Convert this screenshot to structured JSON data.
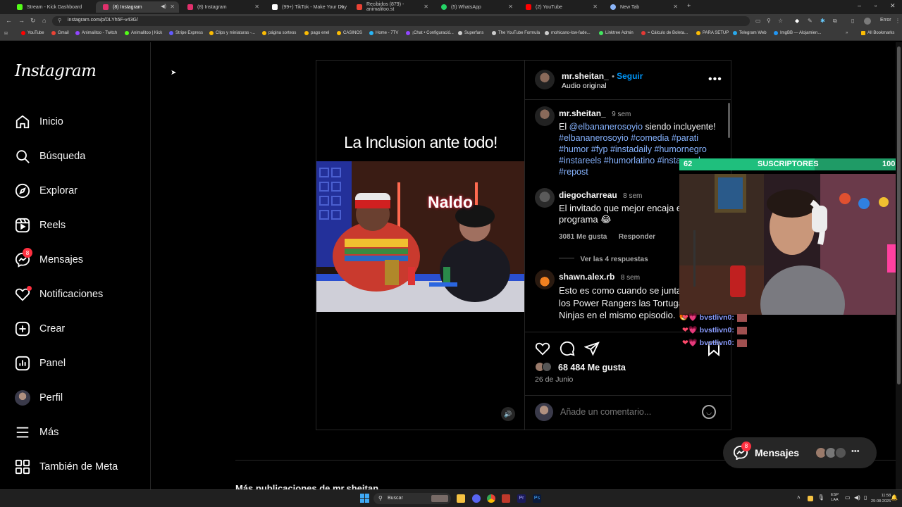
{
  "browser": {
    "tabs": [
      {
        "title": "Stream - Kick Dashboard",
        "color": "#53fc18"
      },
      {
        "title": "(8) Instagram",
        "color": "#e1306c"
      },
      {
        "title": "(8) Instagram",
        "color": "#e1306c"
      },
      {
        "title": "(99+) TikTok - Make Your Day",
        "color": "#ffffff"
      },
      {
        "title": "Recibidos (879) - animalitoo.st",
        "color": "#ea4335"
      },
      {
        "title": "(5) WhatsApp",
        "color": "#25d366"
      },
      {
        "title": "(2) YouTube",
        "color": "#ff0000"
      },
      {
        "title": "New Tab",
        "color": "#8ab4f8"
      }
    ],
    "url": "instagram.com/p/DLYh5F-v43G/",
    "profile_label": "Error",
    "bookmarks": [
      "YouTube",
      "Gmail",
      "Animalitoo - Twitch",
      "Animalitoo | Kick",
      "Stripe Express",
      "Clips y miniaturas -...",
      "página sorteos",
      "pago enel",
      "CASINOS",
      "Home - 7TV",
      "¡Chat • Configuració...",
      "Superfans",
      "The YouTube Formula",
      "mohicano-low-fade...",
      "Linktree Admin",
      "≈ Cálculo de Boleta...",
      "PARA SETUP",
      "Telegram Web",
      "ImgBB — Alojamien..."
    ],
    "all_bookmarks": "All Bookmarks"
  },
  "sidebar": {
    "logo": "Instagram",
    "items": [
      {
        "label": "Inicio",
        "icon": "home-icon"
      },
      {
        "label": "Búsqueda",
        "icon": "search-icon"
      },
      {
        "label": "Explorar",
        "icon": "compass-icon"
      },
      {
        "label": "Reels",
        "icon": "reels-icon"
      },
      {
        "label": "Mensajes",
        "icon": "messenger-icon",
        "badge": "8"
      },
      {
        "label": "Notificaciones",
        "icon": "heart-icon"
      },
      {
        "label": "Crear",
        "icon": "plus-square-icon"
      },
      {
        "label": "Panel",
        "icon": "dashboard-icon"
      },
      {
        "label": "Perfil",
        "icon": "avatar-icon"
      },
      {
        "label": "Más",
        "icon": "menu-icon"
      },
      {
        "label": "También de Meta",
        "icon": "meta-icon"
      }
    ]
  },
  "post": {
    "video_title": "La Inclusion ante todo!",
    "video_logo": "Naldo",
    "author": "mr.sheitan_",
    "follow": "Seguir",
    "audio": "Audio original",
    "caption": {
      "author": "mr.sheitan_",
      "time": "9 sem",
      "pre": "El",
      "mention": "@elbananerosoyio",
      "text": "siendo incluyente!",
      "hashtags": "#elbananerosoyio #comedia #parati #humor #fyp #instadaily #humornegro #instareels #humorlatino #instagood #repost"
    },
    "comments": [
      {
        "author": "diegocharreau",
        "time": "8 sem",
        "text": "El invitado que mejor encaja el programa 😂",
        "likes": "3081 Me gusta",
        "reply": "Responder",
        "replies": "Ver las 4 respuestas"
      },
      {
        "author": "shawn.alex.rb",
        "time": "8 sem",
        "text": "Esto es como cuando se juntaban los Power Rangers las Tortugas Ninjas en el mismo episodio. 🔥"
      }
    ],
    "likes": "68 484 Me gusta",
    "date": "26 de Junio",
    "comment_placeholder": "Añade un comentario..."
  },
  "overlay": {
    "sub_current": "62",
    "sub_label": "SUSCRIPTORES",
    "sub_goal": "100",
    "sub_progress": 0.62,
    "chat_user": "bvstlivn0:"
  },
  "messages_pill": {
    "label": "Mensajes",
    "badge": "8"
  },
  "more_text": "Más publicaciones de mr.sheitan_",
  "taskbar": {
    "search": "Buscar",
    "lang": "ESP",
    "region": "LAA",
    "time": "11:58",
    "date": "29-08-2025"
  }
}
